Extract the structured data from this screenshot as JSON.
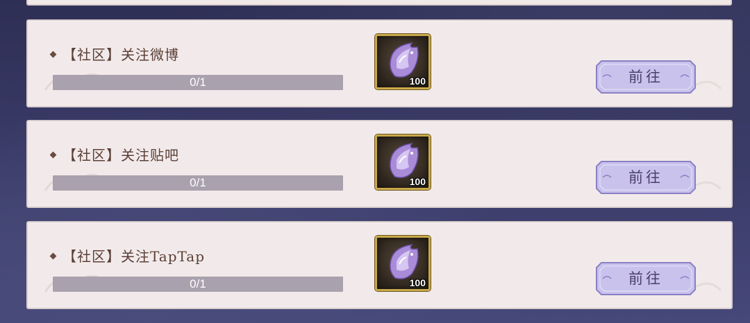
{
  "tasks": [
    {
      "title": "【社区】关注微博",
      "progress_text": "0/1",
      "progress": 0,
      "reward_count": "100",
      "reward_icon": "crystal-icon",
      "button_label": "前往"
    },
    {
      "title": "【社区】关注贴吧",
      "progress_text": "0/1",
      "progress": 0,
      "reward_count": "100",
      "reward_icon": "crystal-icon",
      "button_label": "前往"
    },
    {
      "title": "【社区】关注TapTap",
      "progress_text": "0/1",
      "progress": 0,
      "reward_count": "100",
      "reward_icon": "crystal-icon",
      "button_label": "前往"
    }
  ],
  "colors": {
    "card_bg": "#f2eaea",
    "title_text": "#5a3f36",
    "progress_track": "#a9a1ad",
    "button_fill": "#c9c2ec",
    "button_border": "#8a7fc4",
    "reward_frame": "#c9a94a"
  }
}
